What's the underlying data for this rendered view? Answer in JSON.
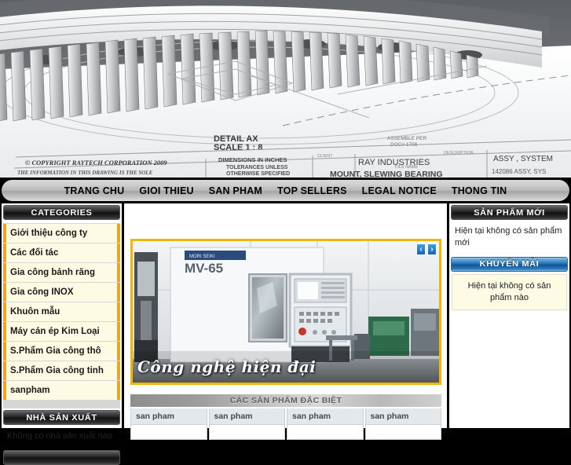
{
  "banner": {
    "alt": "technical-blueprint-slewing-bearing",
    "labels": {
      "detail": "DETAIL AX",
      "scale": "SCALE 1 : 8",
      "copyright": "COPYRIGHT RAYTECH CORPORATION 2009",
      "notice": "THE INFORMATION IN  THIS DRAWING IS THE SOLE",
      "dimensions": "DIMENSIONS IN INCHES",
      "tolerances": "TOLERANCES UNLESS",
      "otherwise": "OTHERWISE SPECIFIED",
      "client_label": "CLIENT",
      "client": "RAY INDUSTRIES",
      "part": "MOUNT, SLEWING BEARING",
      "description_label": "DESCRIPTION",
      "description": "ASSY, SYSTEM",
      "filename_label": "FILE NAME",
      "filename": "142086 ASSY, SYS",
      "assemble": "ASSEMBLE PER",
      "doc": "DOC# 1706"
    }
  },
  "nav": {
    "items": [
      {
        "label": "TRANG CHU"
      },
      {
        "label": "GIOI THIEU"
      },
      {
        "label": "SAN PHAM"
      },
      {
        "label": "TOP SELLERS"
      },
      {
        "label": "LEGAL NOTICE"
      },
      {
        "label": "THONG TIN"
      }
    ]
  },
  "sidebar_left": {
    "categories": {
      "title": "CATEGORIES",
      "items": [
        {
          "label": "Giới thiệu công ty"
        },
        {
          "label": "Các đối tác"
        },
        {
          "label": "Gia công bánh răng"
        },
        {
          "label": "Gia công INOX"
        },
        {
          "label": "Khuôn mẫu"
        },
        {
          "label": "Máy cán ép Kim Loại"
        },
        {
          "label": "S.Phẩm Gia công thô"
        },
        {
          "label": "S.Phẩm Gia công tinh"
        },
        {
          "label": "sanpham"
        }
      ]
    },
    "manufacturers": {
      "title": "NHÀ SẢN XUẤT",
      "empty_text": "Không có nhà sản xuất nào"
    }
  },
  "sidebar_right": {
    "new_products": {
      "title": "SẢN PHẨM MỚI",
      "empty_text": "Hiện tại không có sản phẩm mới"
    },
    "promotions": {
      "title": "KHUYẾN MÃI",
      "empty_text": "Hiện tại không có sản phẩm nào"
    }
  },
  "slideshow": {
    "caption": "Công nghệ hiện đại",
    "machine_label": "MV-65",
    "prev_label": "‹",
    "next_label": "›"
  },
  "products": {
    "title": "CÁC SẢN PHẨM ĐẶC BIỆT",
    "cells": [
      {
        "label": "san pham"
      },
      {
        "label": "san pham"
      },
      {
        "label": "san pham"
      },
      {
        "label": "san pham"
      }
    ]
  },
  "colors": {
    "accent_orange": "#f5a31b",
    "slide_border": "#f2b705",
    "promo_blue": "#1a69ae",
    "page_bg": "#000000"
  }
}
